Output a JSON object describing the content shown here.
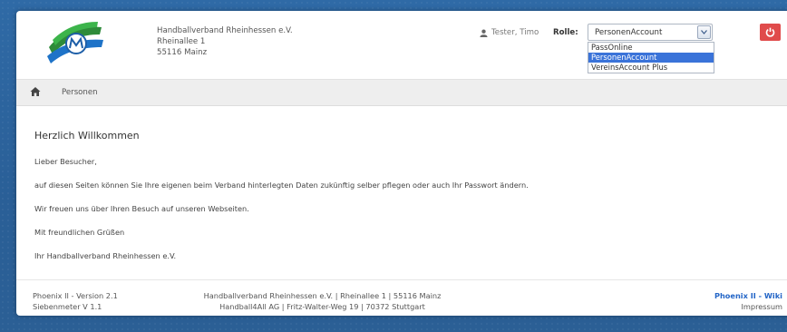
{
  "header": {
    "org_name": "Handballverband Rheinhessen e.V.",
    "org_street": "Rheinallee 1",
    "org_city": "55116 Mainz",
    "user_name": "Tester, Timo",
    "role_label": "Rolle:",
    "role_selected": "PersonenAccount",
    "role_options": [
      "PassOnline",
      "PersonenAccount",
      "VereinsAccount Plus"
    ]
  },
  "nav": {
    "home_icon": "home-icon",
    "link": "Personen"
  },
  "content": {
    "greeting": "Herzlich Willkommen",
    "paragraphs": [
      "Lieber Besucher,",
      "auf diesen Seiten können Sie Ihre eigenen beim Verband hinterlegten Daten zukünftig selber pflegen oder auch Ihr Passwort ändern.",
      "Wir freuen uns über Ihren Besuch auf unseren Webseiten.",
      "Mit freundlichen Grüßen",
      "Ihr Handballverband Rheinhessen e.V."
    ]
  },
  "footer": {
    "version": "Phoenix II - Version 2.1",
    "subversion": "Siebenmeter V 1.1",
    "center_line1": "Handballverband Rheinhessen e.V. | Rheinallee 1 | 55116 Mainz",
    "center_line2": "Handball4All AG | Fritz-Walter-Weg 19 | 70372 Stuttgart",
    "wiki": "Phoenix II - Wiki",
    "impressum": "Impressum"
  },
  "colors": {
    "accent": "#3a73d9",
    "logout": "#e04b4b",
    "link": "#2466c7"
  }
}
